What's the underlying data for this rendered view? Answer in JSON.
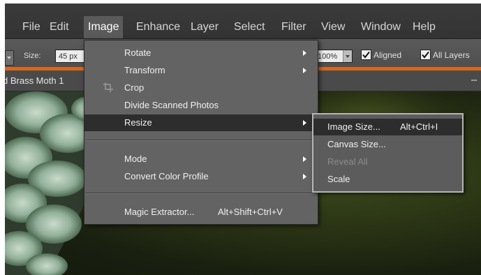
{
  "menubar": {
    "items": [
      "File",
      "Edit",
      "Image",
      "Enhance",
      "Layer",
      "Select",
      "Filter",
      "View",
      "Window",
      "Help"
    ],
    "active": "Image"
  },
  "options": {
    "size_label": "Size:",
    "size_value": "45 px",
    "percent_value": "100%",
    "aligned_label": "Aligned",
    "all_layers_label": "All Layers",
    "aligned_checked": true,
    "all_layers_checked": true
  },
  "document": {
    "title": "d Brass Moth 1",
    "minimize_glyph": "–"
  },
  "image_menu": {
    "items": [
      {
        "label": "Rotate",
        "submenu": true
      },
      {
        "label": "Transform",
        "submenu": true
      },
      {
        "label": "Crop",
        "icon": "crop-icon"
      },
      {
        "label": "Divide Scanned Photos"
      },
      {
        "label": "Resize",
        "submenu": true,
        "highlighted": true
      },
      {
        "label": "Mode",
        "submenu": true
      },
      {
        "label": "Convert Color Profile",
        "submenu": true
      },
      {
        "label": "Magic Extractor...",
        "shortcut": "Alt+Shift+Ctrl+V"
      }
    ]
  },
  "resize_submenu": {
    "items": [
      {
        "label": "Image Size...",
        "shortcut": "Alt+Ctrl+I",
        "highlighted": true
      },
      {
        "label": "Canvas Size..."
      },
      {
        "label": "Reveal All",
        "disabled": true
      },
      {
        "label": "Scale"
      }
    ]
  },
  "colors": {
    "menu_bg": "#636363",
    "highlight": "#2d2d2d",
    "accent_orange": "#d9681b",
    "menubar_bg": "#353535"
  }
}
